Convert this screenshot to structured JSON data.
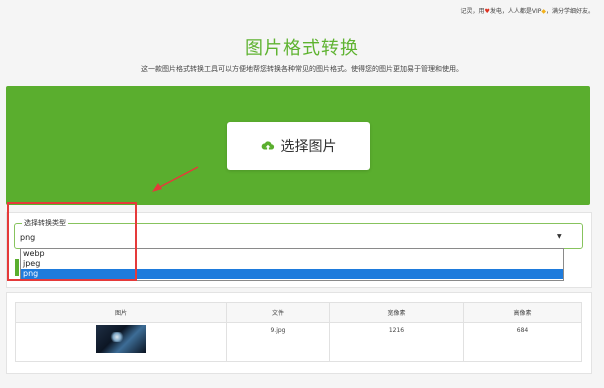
{
  "topbar": {
    "before_heart": "记灵，用",
    "after_heart": "发电，人人都是VIP",
    "after_gem": "，满分学细好友。"
  },
  "header": {
    "title": "图片格式转换",
    "subtitle": "这一款图片格式转换工具可以方便地帮您转换各种常见的图片格式。使得您的图片更加易于管理和使用。"
  },
  "upload": {
    "button_label": "选择图片"
  },
  "convert": {
    "legend": "选择转换类型",
    "selected": "png",
    "options": [
      "webp",
      "jpeg",
      "png"
    ]
  },
  "table": {
    "headers": [
      "图片",
      "文件",
      "宽像素",
      "高像素"
    ],
    "rows": [
      {
        "file": "9.jpg",
        "width": "1216",
        "height": "684"
      }
    ]
  },
  "colors": {
    "brand_green": "#5aae2e",
    "highlight_blue": "#1e7bdc",
    "annotation_red": "#e53a3a"
  }
}
